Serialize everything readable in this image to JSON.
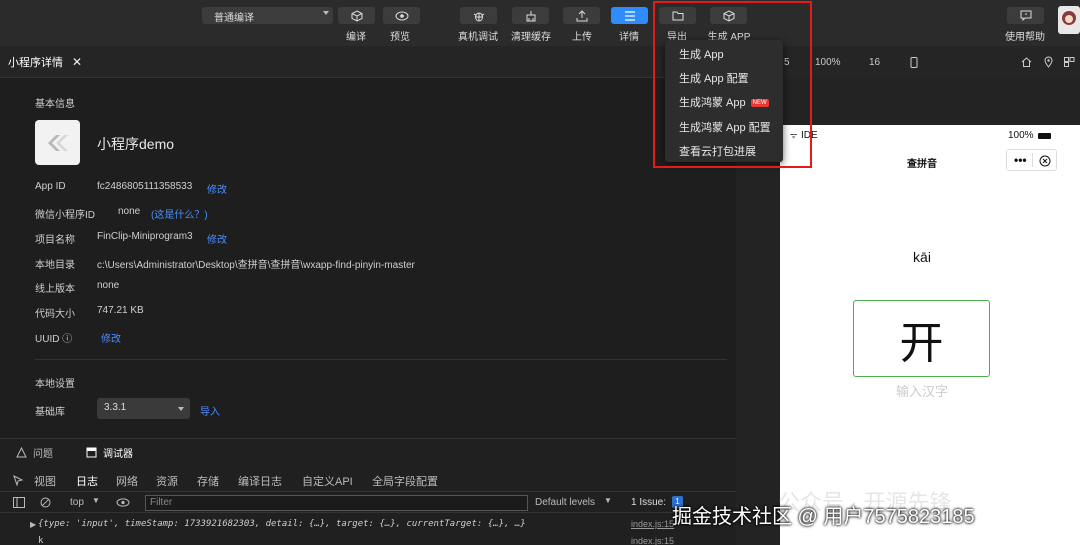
{
  "toolbar": {
    "compile_mode": "普通编译",
    "buttons": {
      "compile": "编译",
      "preview": "预览",
      "remote_debug": "真机调试",
      "clear_cache": "清理缓存",
      "upload": "上传",
      "detail": "详情",
      "export": "导出",
      "generate_app": "生成 APP",
      "help": "使用帮助"
    },
    "accent": "#2f8cff"
  },
  "export_menu": {
    "items": [
      "生成 App",
      "生成 App 配置",
      "生成鸿蒙 App",
      "生成鸿蒙 App 配置",
      "查看云打包进展"
    ],
    "new_badge": "NEW",
    "highlight_color": "#e31b1b"
  },
  "tab": {
    "title": "小程序详情",
    "close": "✕"
  },
  "right_tools": {
    "zoom": "100%",
    "font_size": "16",
    "partial_left": "5"
  },
  "basic_info": {
    "section_title": "基本信息",
    "app_name": "小程序demo",
    "app_id_label": "App ID",
    "app_id": "fc2486805111358533",
    "wechat_id_label": "微信小程序ID",
    "wechat_id": "none",
    "wechat_id_link": "(这是什么？)",
    "project_name_label": "项目名称",
    "project_name": "FinClip-Miniprogram3",
    "local_dir_label": "本地目录",
    "local_dir": "c:\\Users\\Administrator\\Desktop\\查拼音\\查拼音\\wxapp-find-pinyin-master",
    "online_version_label": "线上版本",
    "online_version": "none",
    "code_size_label": "代码大小",
    "code_size": "747.21 KB",
    "uuid_label": "UUID ⓘ",
    "edit_link": "修改"
  },
  "local_settings": {
    "section_title": "本地设置",
    "base_lib_label": "基础库",
    "base_lib_version": "3.3.1",
    "import_link": "导入"
  },
  "console": {
    "tabs": [
      "问题",
      "调试器"
    ],
    "subtabs": [
      "视图",
      "日志",
      "网络",
      "资源",
      "存储",
      "编译日志",
      "自定义API",
      "全局字段配置"
    ],
    "context": "top",
    "filter_placeholder": "Filter",
    "levels": "Default levels",
    "issues": "1 Issue:",
    "issue_count": "1",
    "log_line": "{type: 'input', timeStamp: 1733921682303, detail: {…}, target: {…}, currentTarget: {…}, …}",
    "log_source": "index.js:15",
    "log_source2": "index.js:15",
    "log_line2": "k"
  },
  "simulator": {
    "carrier": "IDE",
    "battery": "100%",
    "page_title": "查拼音",
    "pinyin": "kāi",
    "character": "开",
    "input_placeholder": "输入汉字"
  },
  "watermarks": {
    "public_account": "公众号 · 开源先锋",
    "community": "掘金技术社区 @ 用户7575823185"
  }
}
